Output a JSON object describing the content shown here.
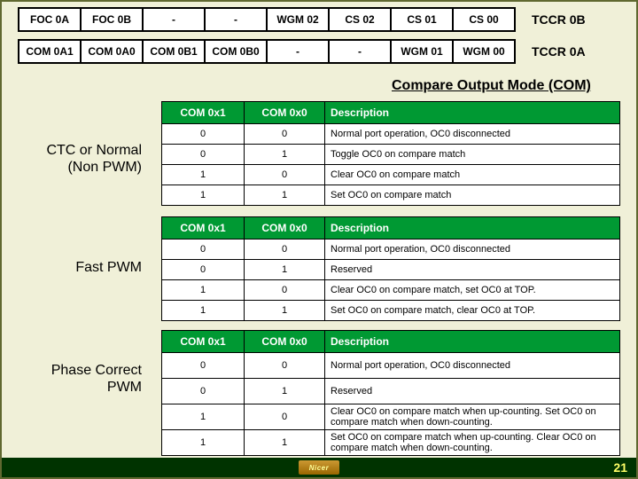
{
  "registers": {
    "row_b": [
      "FOC 0A",
      "FOC 0B",
      "-",
      "-",
      "WGM 02",
      "CS 02",
      "CS 01",
      "CS 00"
    ],
    "label_b": "TCCR 0B",
    "row_a": [
      "COM 0A1",
      "COM 0A0",
      "COM 0B1",
      "COM 0B0",
      "-",
      "-",
      "WGM 01",
      "WGM 00"
    ],
    "label_a": "TCCR 0A"
  },
  "com_title": "Compare Output Mode (COM)",
  "modes": [
    "CTC or Normal\n(Non PWM)",
    "Fast PWM",
    "Phase Correct\nPWM"
  ],
  "tables": [
    {
      "headers": [
        "COM 0x1",
        "COM 0x0",
        "Description"
      ],
      "rows": [
        [
          "0",
          "0",
          "Normal port operation, OC0 disconnected"
        ],
        [
          "0",
          "1",
          "Toggle OC0 on compare match"
        ],
        [
          "1",
          "0",
          "Clear OC0 on compare match"
        ],
        [
          "1",
          "1",
          "Set OC0 on compare match"
        ]
      ]
    },
    {
      "headers": [
        "COM 0x1",
        "COM 0x0",
        "Description"
      ],
      "rows": [
        [
          "0",
          "0",
          "Normal port operation, OC0 disconnected"
        ],
        [
          "0",
          "1",
          "Reserved"
        ],
        [
          "1",
          "0",
          "Clear OC0 on compare match, set OC0 at TOP."
        ],
        [
          "1",
          "1",
          "Set OC0 on compare match, clear OC0 at TOP."
        ]
      ]
    },
    {
      "headers": [
        "COM 0x1",
        "COM 0x0",
        "Description"
      ],
      "rows": [
        [
          "0",
          "0",
          "Normal port operation, OC0 disconnected"
        ],
        [
          "0",
          "1",
          "Reserved"
        ],
        [
          "1",
          "0",
          "Clear OC0 on compare match when up-counting. Set OC0 on compare match when down-counting."
        ],
        [
          "1",
          "1",
          "Set OC0 on compare match when up-counting. Clear OC0 on compare match when down-counting."
        ]
      ]
    }
  ],
  "footer": {
    "logo": "Nicer",
    "page": "21"
  }
}
